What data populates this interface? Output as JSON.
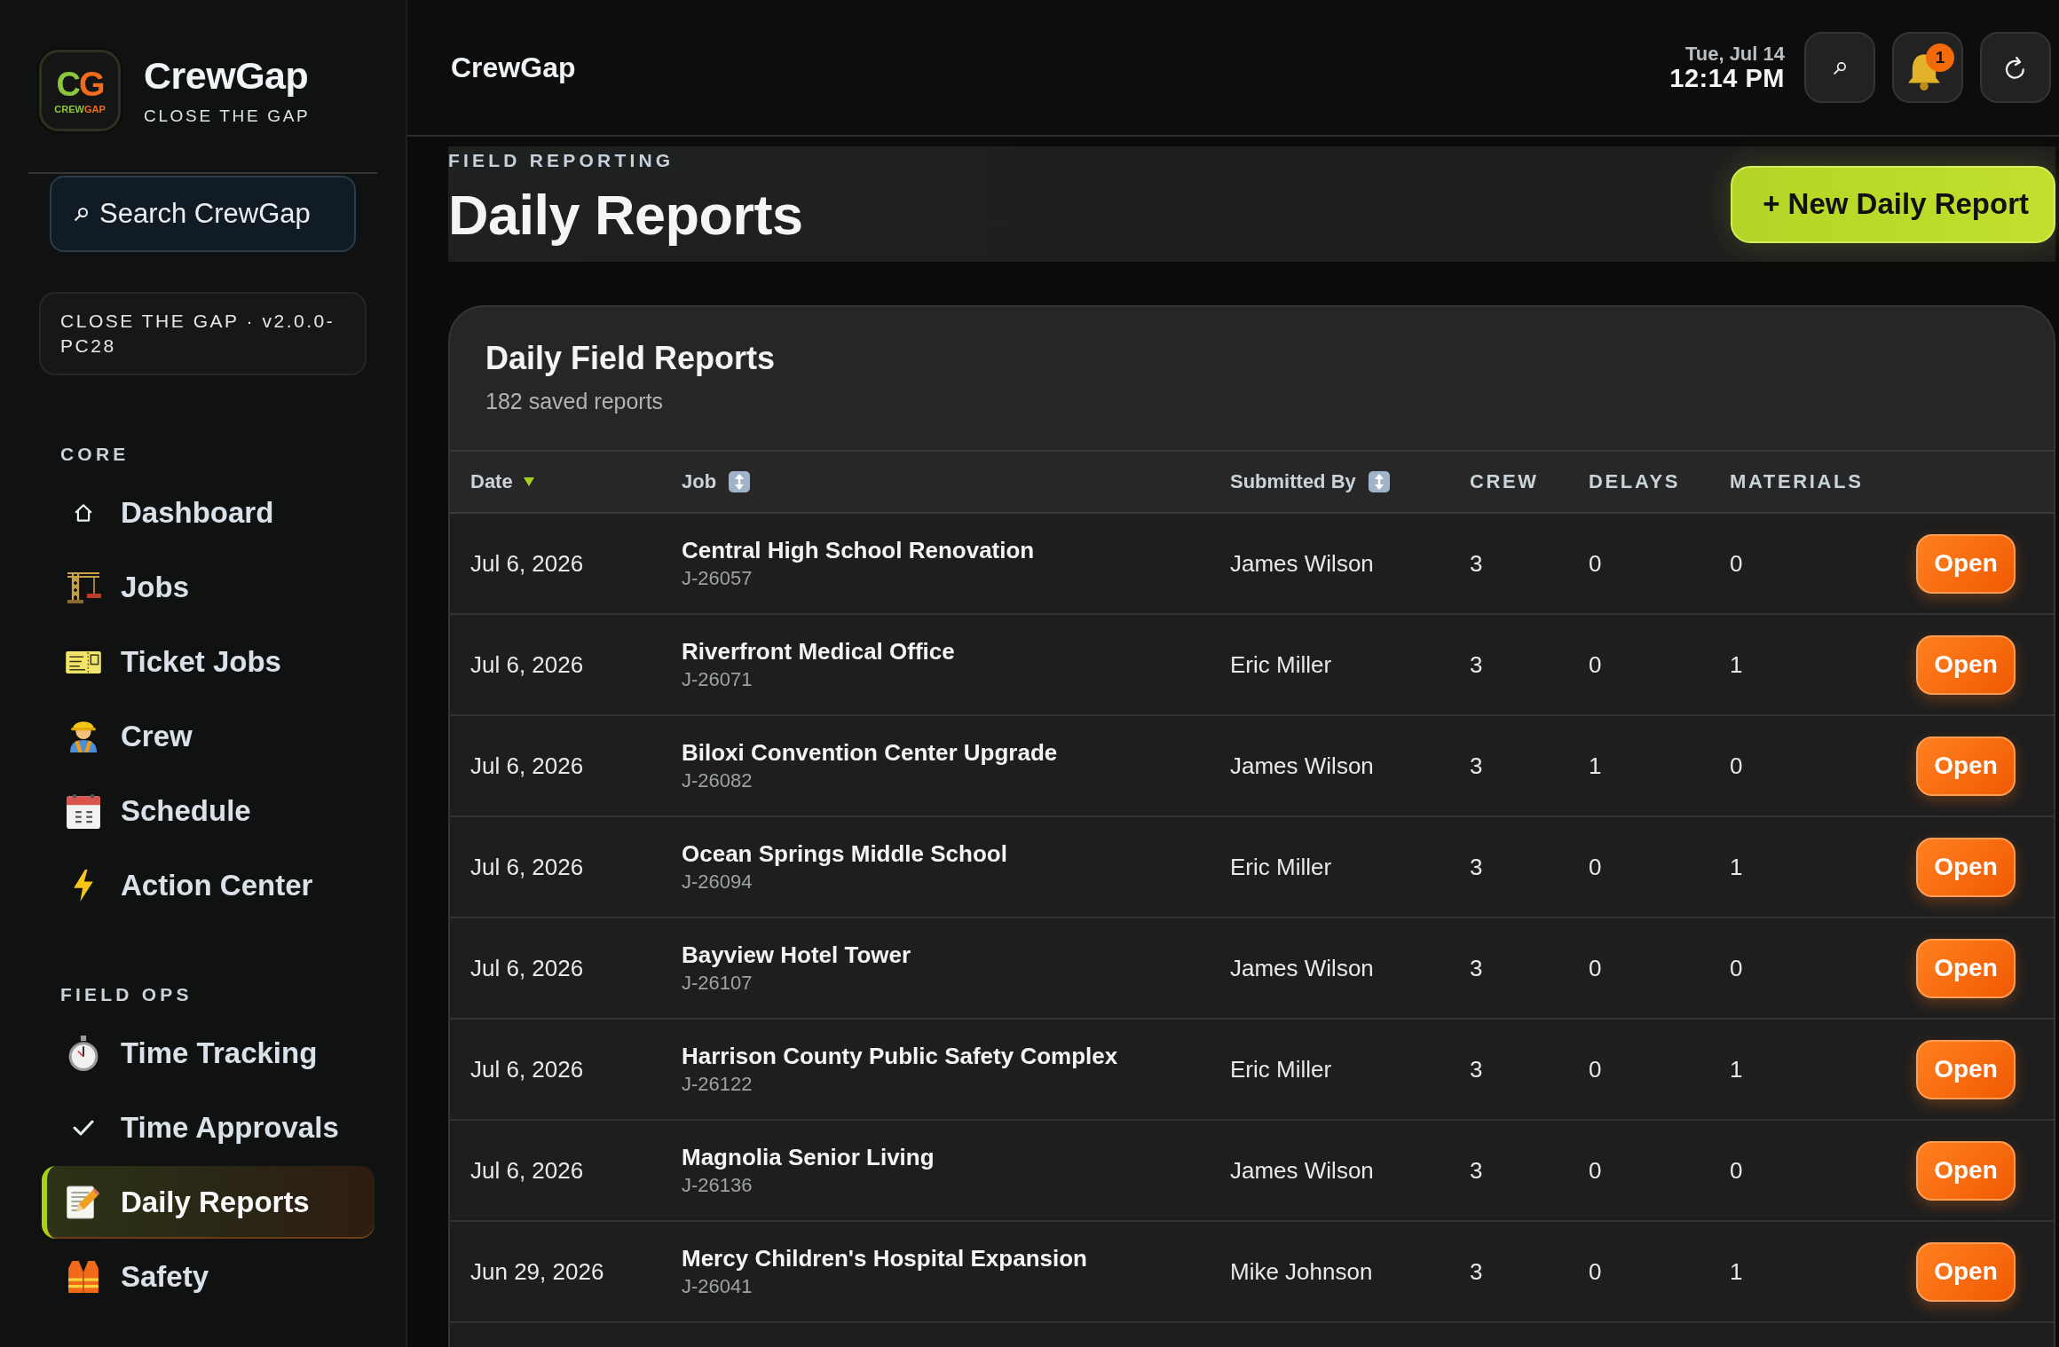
{
  "sidebar": {
    "brand": {
      "logo_monogram": [
        "C",
        "G"
      ],
      "logo_wordmark": [
        "CREW",
        "GAP"
      ],
      "name": "CrewGap",
      "tagline": "CLOSE THE GAP"
    },
    "search": {
      "placeholder": "Search CrewGap"
    },
    "version": "CLOSE THE GAP · v2.0.0-PC28",
    "sections": [
      {
        "title": "CORE",
        "items": [
          {
            "label": "Dashboard",
            "selected": false
          },
          {
            "label": "Jobs",
            "selected": false
          },
          {
            "label": "Ticket Jobs",
            "selected": false
          },
          {
            "label": "Crew",
            "selected": false
          },
          {
            "label": "Schedule",
            "selected": false
          },
          {
            "label": "Action Center",
            "selected": false
          }
        ]
      },
      {
        "title": "FIELD OPS",
        "items": [
          {
            "label": "Time Tracking",
            "selected": false
          },
          {
            "label": "Time Approvals",
            "selected": false
          },
          {
            "label": "Daily Reports",
            "selected": true
          },
          {
            "label": "Safety",
            "selected": false
          }
        ]
      }
    ]
  },
  "top_bar": {
    "title": "CrewGap",
    "date": "Tue, Jul 14",
    "time": "12:14 PM",
    "notification_count": "1"
  },
  "page_header": {
    "eyebrow": "FIELD REPORTING",
    "title": "Daily Reports",
    "action": "+ New Daily Report"
  },
  "reports_card": {
    "title": "Daily Field Reports",
    "subtitle": "182 saved reports",
    "table": {
      "columns": [
        {
          "label": "Date",
          "sortable": true,
          "sorted": true
        },
        {
          "label": "Job",
          "sortable": true,
          "sorted": false
        },
        {
          "label": "Submitted By",
          "sortable": true,
          "sorted": false
        },
        {
          "label": "CREW",
          "sortable": false,
          "sorted": false
        },
        {
          "label": "DELAYS",
          "sortable": false,
          "sorted": false
        },
        {
          "label": "MATERIALS",
          "sortable": false,
          "sorted": false
        }
      ],
      "rows": [
        {
          "date": "Jul 6, 2026",
          "job": "Central High School Renovation",
          "job_id": "J-26057",
          "submitted_by": "James Wilson",
          "crew": "3",
          "delays": "0",
          "materials": "0",
          "action": "Open"
        },
        {
          "date": "Jul 6, 2026",
          "job": "Riverfront Medical Office",
          "job_id": "J-26071",
          "submitted_by": "Eric Miller",
          "crew": "3",
          "delays": "0",
          "materials": "1",
          "action": "Open"
        },
        {
          "date": "Jul 6, 2026",
          "job": "Biloxi Convention Center Upgrade",
          "job_id": "J-26082",
          "submitted_by": "James Wilson",
          "crew": "3",
          "delays": "1",
          "materials": "0",
          "action": "Open"
        },
        {
          "date": "Jul 6, 2026",
          "job": "Ocean Springs Middle School",
          "job_id": "J-26094",
          "submitted_by": "Eric Miller",
          "crew": "3",
          "delays": "0",
          "materials": "1",
          "action": "Open"
        },
        {
          "date": "Jul 6, 2026",
          "job": "Bayview Hotel Tower",
          "job_id": "J-26107",
          "submitted_by": "James Wilson",
          "crew": "3",
          "delays": "0",
          "materials": "0",
          "action": "Open"
        },
        {
          "date": "Jul 6, 2026",
          "job": "Harrison County Public Safety Complex",
          "job_id": "J-26122",
          "submitted_by": "Eric Miller",
          "crew": "3",
          "delays": "0",
          "materials": "1",
          "action": "Open"
        },
        {
          "date": "Jul 6, 2026",
          "job": "Magnolia Senior Living",
          "job_id": "J-26136",
          "submitted_by": "James Wilson",
          "crew": "3",
          "delays": "0",
          "materials": "0",
          "action": "Open"
        },
        {
          "date": "Jun 29, 2026",
          "job": "Mercy Children's Hospital Expansion",
          "job_id": "J-26041",
          "submitted_by": "Mike Johnson",
          "crew": "3",
          "delays": "0",
          "materials": "1",
          "action": "Open"
        }
      ]
    }
  }
}
